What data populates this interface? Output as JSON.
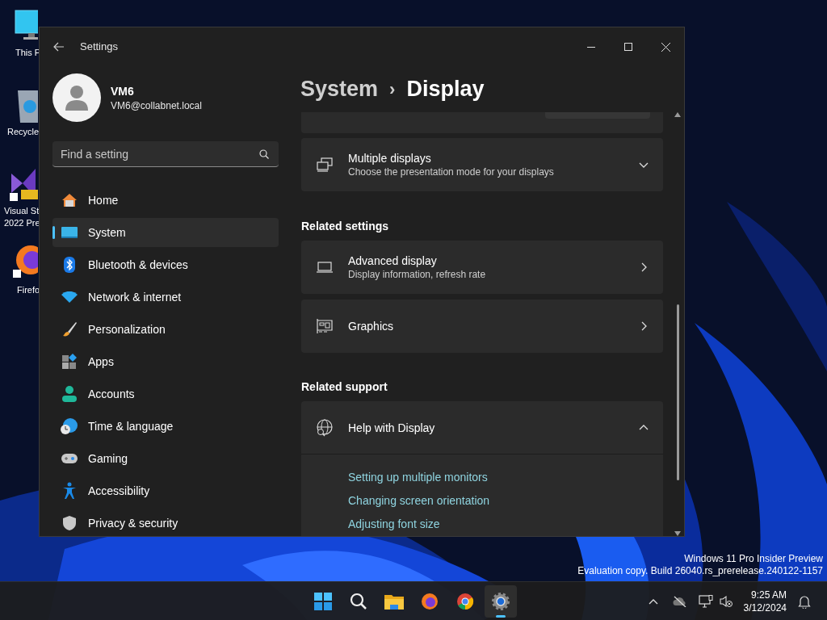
{
  "desktop_icons": [
    {
      "lines": [
        "This P"
      ]
    },
    {
      "lines": [
        "Recycle"
      ]
    },
    {
      "lines": [
        "Visual St",
        "2022 Pre"
      ]
    },
    {
      "lines": [
        "Firefo"
      ]
    }
  ],
  "window": {
    "title": "Settings"
  },
  "profile": {
    "name": "VM6",
    "email": "VM6@collabnet.local"
  },
  "search": {
    "placeholder": "Find a setting"
  },
  "nav": [
    {
      "label": "Home",
      "selected": false
    },
    {
      "label": "System",
      "selected": true
    },
    {
      "label": "Bluetooth & devices",
      "selected": false
    },
    {
      "label": "Network & internet",
      "selected": false
    },
    {
      "label": "Personalization",
      "selected": false
    },
    {
      "label": "Apps",
      "selected": false
    },
    {
      "label": "Accounts",
      "selected": false
    },
    {
      "label": "Time & language",
      "selected": false
    },
    {
      "label": "Gaming",
      "selected": false
    },
    {
      "label": "Accessibility",
      "selected": false
    },
    {
      "label": "Privacy & security",
      "selected": false
    }
  ],
  "breadcrumb": {
    "parent": "System",
    "separator": "›",
    "current": "Display"
  },
  "content": [
    {
      "kind": "expander",
      "title": "Multiple displays",
      "subtitle": "Choose the presentation mode for your displays",
      "expanded": false
    },
    {
      "kind": "heading",
      "text": "Related settings"
    },
    {
      "kind": "link",
      "title": "Advanced display",
      "subtitle": "Display information, refresh rate"
    },
    {
      "kind": "link",
      "title": "Graphics"
    },
    {
      "kind": "heading",
      "text": "Related support"
    },
    {
      "kind": "expander",
      "title": "Help with Display",
      "expanded": true,
      "links": [
        "Setting up multiple monitors",
        "Changing screen orientation",
        "Adjusting font size"
      ]
    }
  ],
  "watermark": [
    "Windows 11 Pro Insider Preview",
    "Evaluation copy. Build 26040.rs_prerelease.240122-1157"
  ],
  "taskbar": {
    "apps": [
      {
        "selected": false
      },
      {
        "selected": false
      },
      {
        "selected": false
      },
      {
        "selected": false
      },
      {
        "selected": false
      },
      {
        "selected": true
      }
    ],
    "time": "9:25 AM",
    "date": "3/12/2024"
  }
}
